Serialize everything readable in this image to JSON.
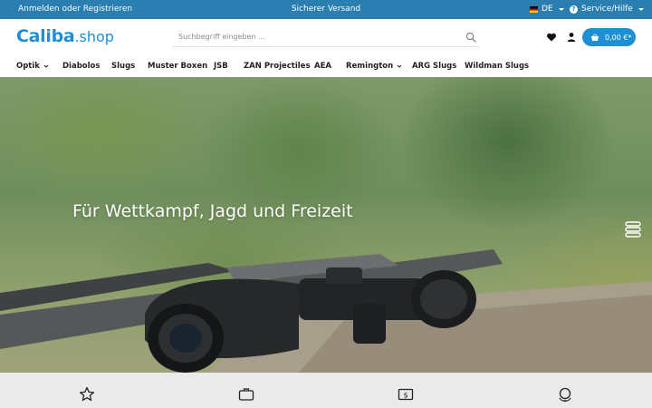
{
  "topbar": {
    "login_label": "Anmelden oder Registrieren",
    "center_text": "Sicherer Versand",
    "language_label": "DE",
    "service_label": "Service/Hilfe"
  },
  "header": {
    "logo_brand": "Caliba",
    "logo_tld": ".shop",
    "search_placeholder": "Suchbegriff eingeben ...",
    "cart_total": "0,00 €*"
  },
  "nav": {
    "items": [
      {
        "label": "Optik",
        "has_dropdown": true
      },
      {
        "label": "Diabolos"
      },
      {
        "label": "Slugs"
      },
      {
        "label": "Muster Boxen"
      },
      {
        "label": "JSB"
      },
      {
        "label": "ZAN Projectiles"
      },
      {
        "label": "AEA"
      },
      {
        "label": "Remington",
        "has_dropdown": true
      },
      {
        "label": "ARG Slugs"
      },
      {
        "label": "Wildman Slugs"
      }
    ]
  },
  "hero": {
    "headline": "Für Wettkampf, Jagd und Freizeit"
  },
  "features": {
    "icons": [
      "star-icon",
      "briefcase-icon",
      "dollar-bill-icon",
      "globe-icon"
    ]
  },
  "colors": {
    "brand_blue": "#2a7fb0",
    "accent_blue": "#1f8fd3"
  }
}
